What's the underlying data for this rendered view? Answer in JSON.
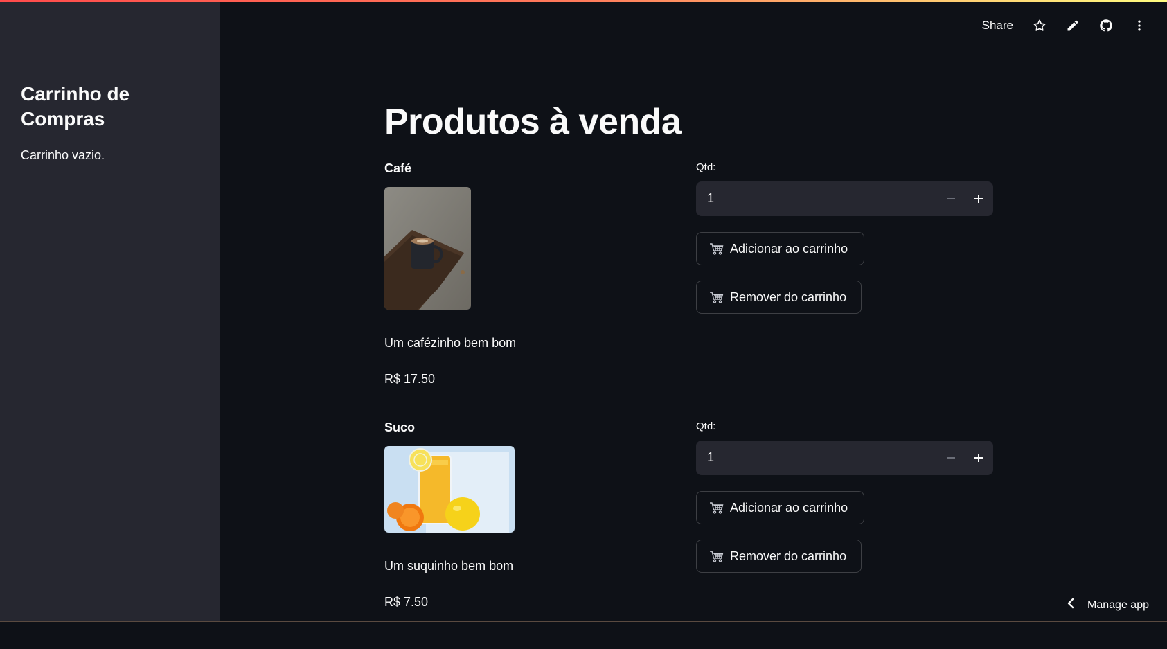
{
  "sidebar": {
    "title": "Carrinho de Compras",
    "cart_status": "Carrinho vazio."
  },
  "toolbar": {
    "share_label": "Share",
    "icons": [
      "star-icon",
      "pencil-icon",
      "github-icon",
      "more-vertical-icon"
    ]
  },
  "main": {
    "title": "Produtos à venda",
    "products": [
      {
        "name": "Café",
        "description": "Um cafézinho bem bom",
        "price": "R$ 17.50",
        "qty_label": "Qtd:",
        "qty_value": "1",
        "add_label": "Adicionar ao carrinho",
        "remove_label": "Remover do carrinho"
      },
      {
        "name": "Suco",
        "description": "Um suquinho bem bom",
        "price": "R$ 7.50",
        "qty_label": "Qtd:",
        "qty_value": "1",
        "add_label": "Adicionar ao carrinho",
        "remove_label": "Remover do carrinho"
      }
    ]
  },
  "footer": {
    "manage_label": "Manage app"
  },
  "colors": {
    "background": "#0e1117",
    "sidebar": "#262730",
    "accent": "#ff4b4b",
    "text": "#fafafa"
  }
}
